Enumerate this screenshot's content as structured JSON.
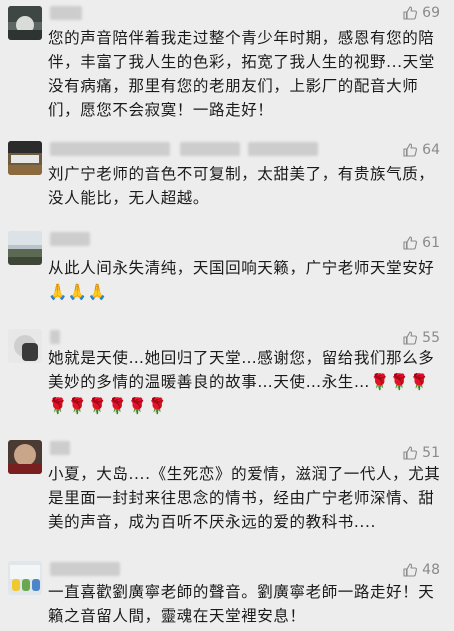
{
  "comments": [
    {
      "likes": "69",
      "text": "您的声音陪伴着我走过整个青少年时期，感恩有您的陪伴，丰富了我人生的色彩，拓宽了我人生的视野...天堂没有病痛，那里有您的老朋友们，上影厂的配音大师们，愿您不会寂寞！一路走好！"
    },
    {
      "likes": "64",
      "text": "刘广宁老师的音色不可复制，太甜美了，有贵族气质，没人能比，无人超越。"
    },
    {
      "likes": "61",
      "text": "从此人间永失清纯，天国回响天籁，广宁老师天堂安好🙏🙏🙏"
    },
    {
      "likes": "55",
      "text": "她就是天使…她回归了天堂…感谢您，留给我们那么多美妙的多情的温暖善良的故事…天使…永生…🌹🌹🌹🌹🌹🌹🌹🌹🌹"
    },
    {
      "likes": "51",
      "text": "小夏，大岛....《生死恋》的爱情，滋润了一代人，尤其是里面一封封来往思念的情书，经由广宁老师深情、甜美的声音，成为百听不厌永远的爱的教科书...."
    },
    {
      "likes": "48",
      "text": "一直喜歡劉廣寧老師的聲音。劉廣寧老師一路走好！天籟之音留人間，靈魂在天堂裡安息！"
    }
  ],
  "icons": {
    "like": "thumbs-up-icon"
  },
  "colors": {
    "background": "#ededed",
    "text": "#1a1a1a",
    "meta": "#8a8a8a"
  }
}
